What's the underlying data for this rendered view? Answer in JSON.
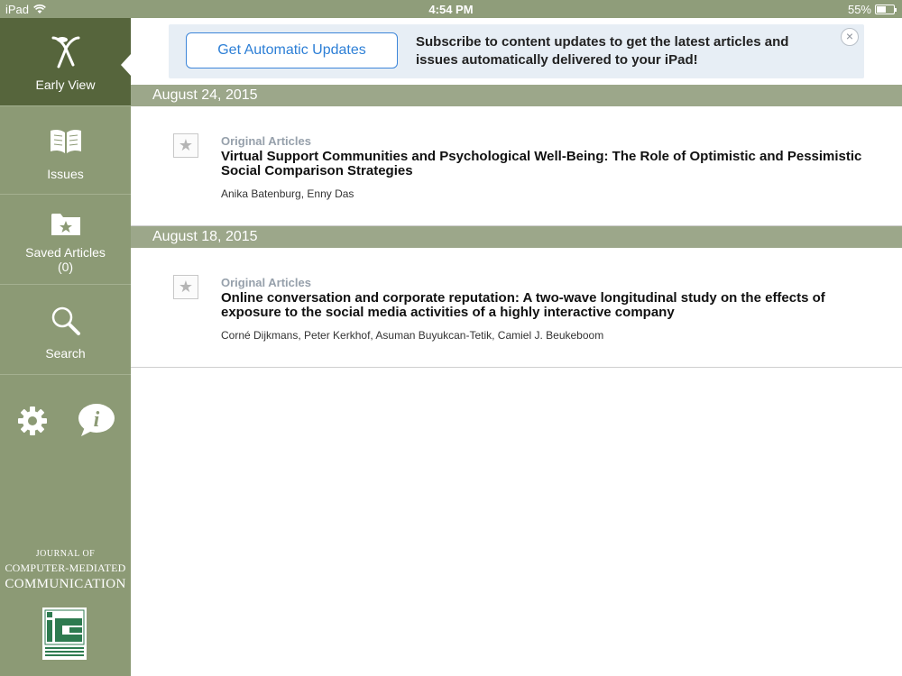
{
  "status_bar": {
    "device": "iPad",
    "time": "4:54 PM",
    "battery": "55%",
    "battery_level": 0.55
  },
  "sidebar": {
    "items": [
      {
        "label": "Early View",
        "icon": "early-view-icon",
        "active": true
      },
      {
        "label": "Issues",
        "icon": "open-book-icon"
      },
      {
        "label": "Saved Articles",
        "sub_label": "(0)",
        "icon": "folder-star-icon"
      },
      {
        "label": "Search",
        "icon": "magnifier-icon"
      }
    ],
    "utility_icons": [
      "gear-icon",
      "info-icon"
    ],
    "journal": {
      "line1": "Journal of",
      "line2": "Computer-Mediated",
      "line3": "Communication"
    },
    "logo": "ica-logo"
  },
  "banner": {
    "button_label": "Get Automatic Updates",
    "message": "Subscribe to content updates to get the latest articles and issues automatically delivered to your iPad!",
    "close_icon": "close-icon"
  },
  "sections": [
    {
      "date": "August 24, 2015",
      "articles": [
        {
          "category": "Original Articles",
          "title": "Virtual Support Communities and Psychological Well-Being: The Role of Optimistic and Pessimistic Social Comparison Strategies",
          "authors": "Anika Batenburg, Enny Das"
        }
      ]
    },
    {
      "date": "August 18, 2015",
      "articles": [
        {
          "category": "Original Articles",
          "title": "Online conversation and corporate reputation: A two-wave longitudinal study on the effects of exposure to the social media activities of a highly interactive company",
          "authors": "Corné Dijkmans, Peter Kerkhof, Asuman Buyukcan-Tetik, Camiel J. Beukeboom"
        }
      ]
    }
  ]
}
